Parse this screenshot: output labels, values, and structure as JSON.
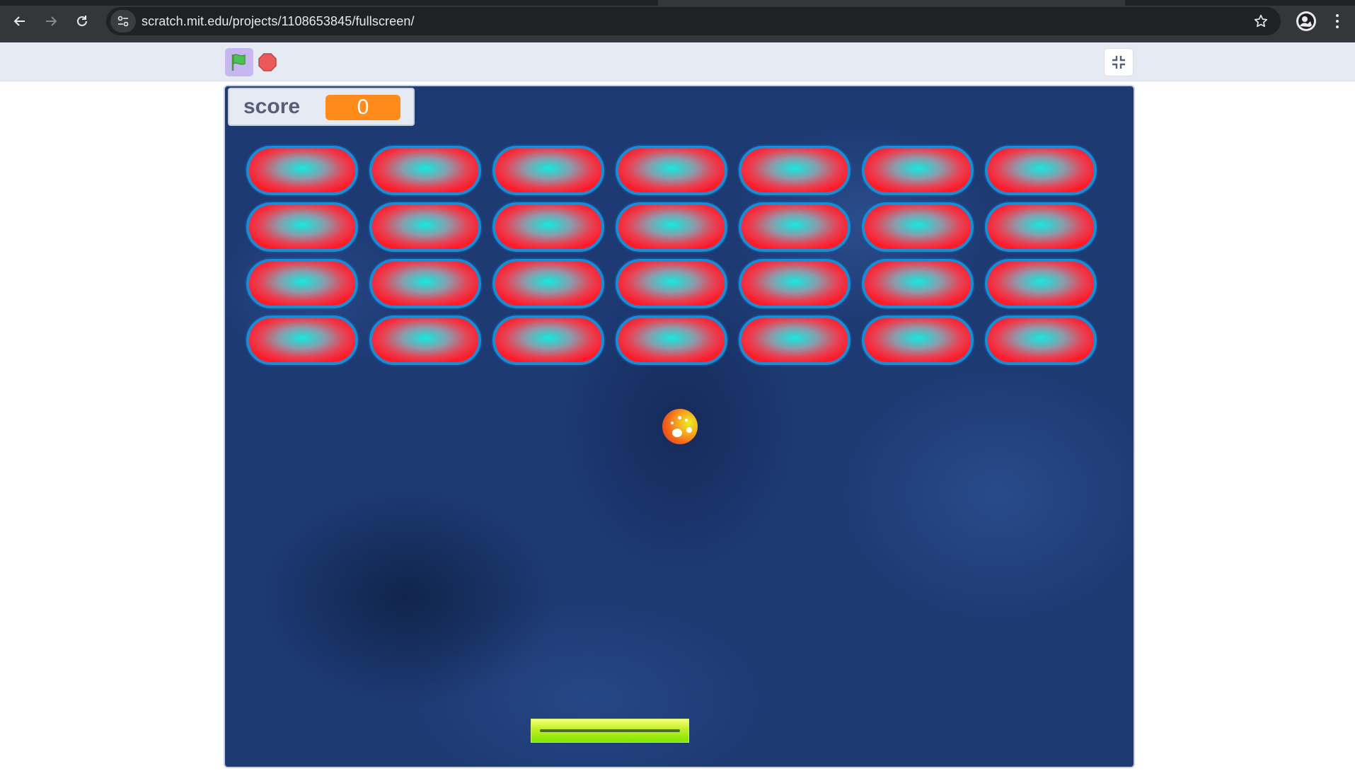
{
  "browser": {
    "url": "scratch.mit.edu/projects/1108653845/fullscreen/"
  },
  "stage": {
    "score_label": "score",
    "score_value": "0",
    "bricks": {
      "rows": 4,
      "columns": 7
    }
  },
  "colors": {
    "chrome_bg": "#35363a",
    "controls_bg": "#e6ebf3",
    "score_value_bg": "#ff8c1a",
    "stage_bg": "#1d3a73",
    "brick_border": "#1d8bd1",
    "brick_center": "#1de7df",
    "brick_edge": "#ff1a2a",
    "paddle": "#9cf016"
  }
}
